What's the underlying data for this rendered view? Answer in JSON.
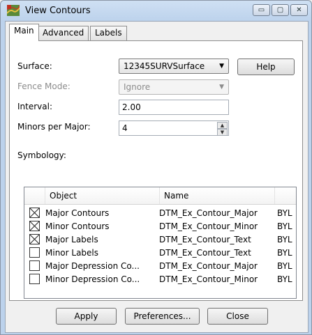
{
  "window": {
    "title": "View Contours",
    "minimize_glyph": "▭",
    "maximize_glyph": "▢",
    "close_glyph": "✕"
  },
  "tabs": [
    {
      "label": "Main",
      "active": true
    },
    {
      "label": "Advanced",
      "active": false
    },
    {
      "label": "Labels",
      "active": false
    }
  ],
  "main": {
    "surface_label": "Surface:",
    "surface_value": "12345SURVSurface",
    "help_label": "Help",
    "fence_mode_label": "Fence Mode:",
    "fence_mode_value": "Ignore",
    "interval_label": "Interval:",
    "interval_value": "2.00",
    "minors_label": "Minors per Major:",
    "minors_value": "4",
    "symbology_label": "Symbology:"
  },
  "symbology": {
    "columns": [
      "Object",
      "Name"
    ],
    "rows": [
      {
        "checked": true,
        "object": "Major Contours",
        "name": "DTM_Ex_Contour_Major",
        "extra": "BYL"
      },
      {
        "checked": true,
        "object": "Minor Contours",
        "name": "DTM_Ex_Contour_Minor",
        "extra": "BYL"
      },
      {
        "checked": true,
        "object": "Major Labels",
        "name": "DTM_Ex_Contour_Text",
        "extra": "BYL"
      },
      {
        "checked": false,
        "object": "Minor Labels",
        "name": "DTM_Ex_Contour_Text",
        "extra": "BYL"
      },
      {
        "checked": false,
        "object": "Major Depression Co...",
        "name": "DTM_Ex_Contour_Major",
        "extra": "BYL"
      },
      {
        "checked": false,
        "object": "Minor Depression Co...",
        "name": "DTM_Ex_Contour_Minor",
        "extra": "BYL"
      }
    ]
  },
  "footer": {
    "apply_label": "Apply",
    "preferences_label": "Preferences...",
    "close_label": "Close"
  },
  "icons": {
    "app": "contour-map-icon",
    "dropdown": "chevron-down-icon",
    "spin_up": "spin-up-icon",
    "spin_down": "spin-down-icon"
  }
}
